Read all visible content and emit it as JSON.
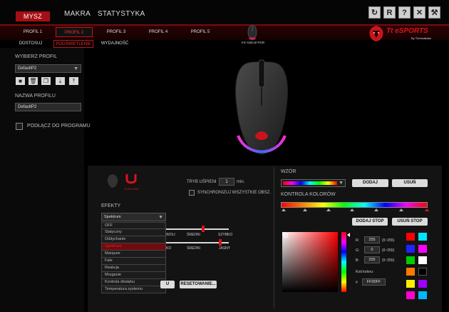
{
  "topnav": {
    "items": [
      "MYSZ",
      "MAKRA",
      "STATYSTYKA"
    ]
  },
  "window_buttons": [
    "refresh-icon",
    "reset-icon",
    "help-icon",
    "close-icon",
    "tools-icon"
  ],
  "profiles": {
    "tabs": [
      "PROFIL 1",
      "PROFIL 2",
      "PROFIL 3",
      "PROFIL 4",
      "PROFIL 5"
    ],
    "active": 1
  },
  "subtabs": {
    "items": [
      "DOSTOSUJ",
      "PODŚWIETLENIE",
      "WYDAJNOŚĆ"
    ],
    "active": 1
  },
  "device": {
    "name": "Iris Optical RGB"
  },
  "brand": {
    "logo_text": "Tt eSPORTS",
    "logo_sub": "By Thermaltake"
  },
  "left": {
    "choose_profile_label": "WYBIERZ PROFIL",
    "profile_value": "DefaultP2",
    "profile_name_label": "NAZWA PROFILU",
    "profile_name_value": "DefaultP2",
    "link_program_label": "PODŁĄCZ DO PROGRAMU"
  },
  "lighting": {
    "sleep_label": "TRYB UŚPIENI",
    "sleep_value": "1",
    "sleep_unit": "min.",
    "sync_label": "SYNCHRONIZUJ WSZYSTKIE OBSZ.",
    "zone_label": "RGB AURA",
    "effects_label": "EFEKTY",
    "effect_selected": "Spektrum",
    "effect_options": [
      "OFF",
      "Statyczny",
      "Oddychanie",
      "Spektrum",
      "Marquee",
      "Fale",
      "Reakcja",
      "Mruganie",
      "Kontrola dźwięku",
      "Temperatura systemu"
    ],
    "speed_labels": [
      "WOLI",
      "ŚREDNI",
      "SZYBKO"
    ],
    "brightness_labels": [
      "KO",
      "ŚREDNI",
      "JASNY"
    ],
    "apply_button": "U",
    "reset_button": "RESETOWANIE..."
  },
  "pattern": {
    "label": "WZÓR",
    "add_button": "DODAJ",
    "remove_button": "USUŃ",
    "color_control_label": "KONTROLA KOLORÓW",
    "add_stop_button": "DODAJ STOP",
    "remove_stop_button": "USUŃ STOP"
  },
  "color": {
    "r_label": "R:",
    "r_value": "255",
    "r_range": "(0~255)",
    "g_label": "G:",
    "g_value": "0",
    "g_range": "(0~255)",
    "b_label": "B:",
    "b_value": "255",
    "b_range": "(0~255)",
    "code_label": "Kod koloru:",
    "hash": "#",
    "code_value": "FF00FF"
  },
  "swatches": [
    "#ff0000",
    "#00e5ff",
    "#1f23ff",
    "#ff00ff",
    "#00cc00",
    "#ffffff",
    "#ff7a00",
    "#000000",
    "#ffee00",
    "#a000ff",
    "#ff00cc",
    "#00b7ff"
  ]
}
